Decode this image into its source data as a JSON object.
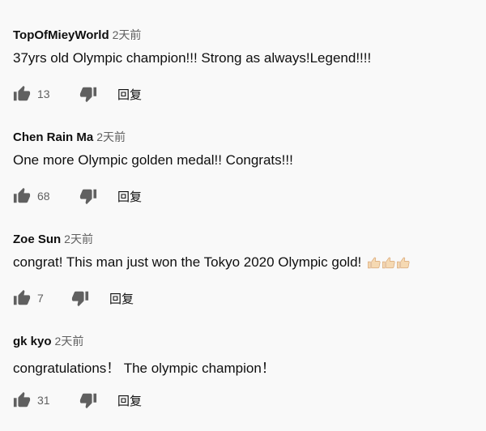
{
  "comments": [
    {
      "author": "TopOfMieyWorld",
      "time": "2天前",
      "text": "37yrs old Olympic champion!!! Strong as always!Legend!!!!",
      "likes": "13",
      "reply_label": "回复"
    },
    {
      "author": "Chen Rain Ma",
      "time": "2天前",
      "text": "One more Olympic golden medal!! Congrats!!!",
      "likes": "68",
      "reply_label": "回复"
    },
    {
      "author": "Zoe Sun",
      "time": "2天前",
      "text": "congrat! This man just won the Tokyo 2020 Olympic gold!",
      "emoji": [
        "thumbs-up-emoji",
        "thumbs-up-emoji",
        "thumbs-up-emoji"
      ],
      "likes": "7",
      "reply_label": "回复"
    },
    {
      "author": "gk kyo",
      "time": "2天前",
      "text": "congratulations！ The olympic champion！",
      "likes": "31",
      "reply_label": "回复"
    }
  ],
  "icons": {
    "like": "thumb-up-icon",
    "dislike": "thumb-down-icon"
  },
  "colors": {
    "background": "#f9f9f9",
    "icon": "#606060",
    "secondary_text": "#606060"
  }
}
